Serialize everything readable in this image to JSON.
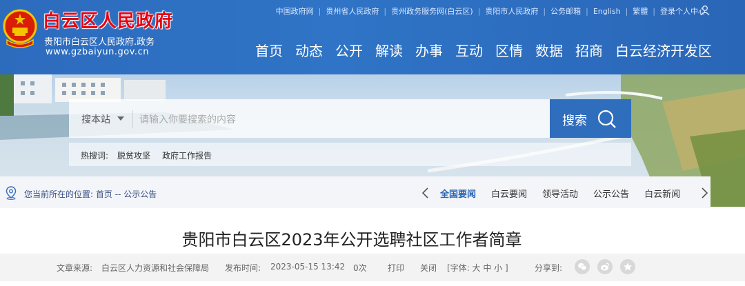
{
  "header": {
    "site_title": "白云区人民政府",
    "site_subtitle": "贵阳市白云区人民政府.政务",
    "site_url": "www.gzbaiyun.gov.cn",
    "top_links": [
      "中国政府网",
      "贵州省人民政府",
      "贵州政务服务网(白云区)",
      "贵阳市人民政府",
      "公务邮箱",
      "English",
      "繁體",
      "登录个人中心"
    ],
    "nav": [
      "首页",
      "动态",
      "公开",
      "解读",
      "办事",
      "互动",
      "区情",
      "数据",
      "招商",
      "白云经济开发区"
    ],
    "icons": {
      "emblem": "national-emblem-icon",
      "user": "user-icon"
    },
    "colors": {
      "bar": "#2f6dbd",
      "title_red": "#e60012"
    }
  },
  "search": {
    "scope_label": "搜本站",
    "placeholder": "请输入你要搜索的内容",
    "button_label": "搜索",
    "hot_label": "热搜词:",
    "hot_keywords": [
      "脱贫攻坚",
      "政府工作报告"
    ]
  },
  "breadcrumb": {
    "prefix": "您当前所在的位置:",
    "home": "首页",
    "separator": "--",
    "current": "公示公告"
  },
  "tabs": [
    "全国要闻",
    "白云要闻",
    "领导活动",
    "公示公告",
    "白云新闻"
  ],
  "active_tab": "全国要闻",
  "article": {
    "title": "贵阳市白云区2023年公开选聘社区工作者简章",
    "source_label": "文章来源:",
    "source": "白云区人力资源和社会保障局",
    "time_label": "发布时间:",
    "time": "2023-05-15 13:42",
    "views": "0次",
    "print": "打印",
    "close": "关闭",
    "font_size": "[字体: 大 中 小 ]",
    "share_label": "分享到:",
    "share_icons": [
      "wechat-icon",
      "weibo-icon",
      "qzone-icon"
    ]
  }
}
